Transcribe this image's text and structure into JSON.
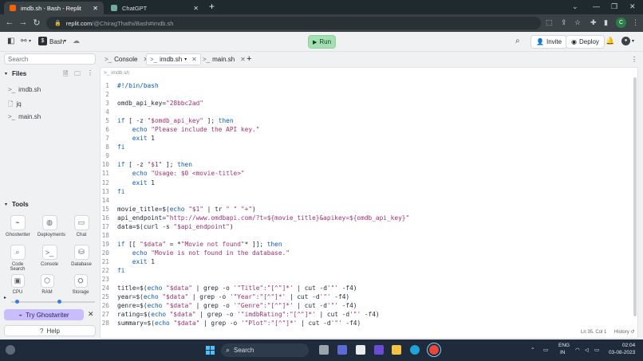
{
  "browser": {
    "tabs": [
      {
        "title": "imdb.sh - Bash - Replit",
        "active": true,
        "favicon_color": "#f26207"
      },
      {
        "title": "ChatGPT",
        "active": false,
        "favicon_color": "#74aa9c"
      }
    ],
    "new_tab": "+",
    "url_host": "replit.com",
    "url_path": "/@ChiragThathi/Bash#imdb.sh",
    "window_controls": [
      "chevron-down-icon",
      "minimize-icon",
      "restore-icon",
      "close-icon"
    ]
  },
  "replit_header": {
    "repl_name": "Bash",
    "run_label": "Run",
    "invite_label": "Invite",
    "deploy_label": "Deploy"
  },
  "sidebar": {
    "search_placeholder": "Search",
    "files_heading": "Files",
    "files": [
      {
        "name": "imdb.sh",
        "icon": "terminal-icon"
      },
      {
        "name": "jq",
        "icon": "file-icon"
      },
      {
        "name": "main.sh",
        "icon": "terminal-icon"
      }
    ],
    "tools_heading": "Tools",
    "tools": [
      {
        "label": "Ghostwriter",
        "icon": "ghostwriter-icon"
      },
      {
        "label": "Deployments",
        "icon": "globe-icon"
      },
      {
        "label": "Chat",
        "icon": "chat-icon"
      },
      {
        "label": "Code Search",
        "icon": "search-icon"
      },
      {
        "label": "Console",
        "icon": "terminal-icon"
      },
      {
        "label": "Database",
        "icon": "database-icon"
      }
    ],
    "resources": [
      {
        "label": "CPU",
        "level": 0.05
      },
      {
        "label": "RAM",
        "level": 0.55
      },
      {
        "label": "Storage",
        "level": 0.3
      }
    ],
    "ghostwriter_button": "Try Ghostwriter",
    "help_label": "Help"
  },
  "editor": {
    "tabs": [
      {
        "label": "Console",
        "active": false
      },
      {
        "label": "imdb.sh",
        "active": true
      },
      {
        "label": "main.sh",
        "active": false
      }
    ],
    "breadcrumb": "imdb.sh",
    "lines": [
      "#!/bin/bash",
      "",
      "omdb_api_key=\"28bbc2ad\"",
      "",
      "if [ -z \"$omdb_api_key\" ]; then",
      "    echo \"Please include the API key.\"",
      "    exit 1",
      "fi",
      "",
      "if [ -z \"$1\" ]; then",
      "    echo \"Usage: $0 <movie-title>\"",
      "    exit 1",
      "fi",
      "",
      "movie_title=$(echo \"$1\" | tr \" \" \"+\")",
      "api_endpoint=\"http://www.omdbapi.com/?t=${movie_title}&apikey=${omdb_api_key}\"",
      "data=$(curl -s \"$api_endpoint\")",
      "",
      "if [[ \"$data\" = *\"Movie not found\"* ]]; then",
      "    echo \"Movie is not found in the database.\"",
      "    exit 1",
      "fi",
      "",
      "title=$(echo \"$data\" | grep -o '\"Title\":\"[^\"]*' | cut -d'\"' -f4)",
      "year=$(echo \"$data\" | grep -o '\"Year\":\"[^\"]*' | cut -d'\"' -f4)",
      "genre=$(echo \"$data\" | grep -o '\"Genre\":\"[^\"]*' | cut -d'\"' -f4)",
      "rating=$(echo \"$data\" | grep -o '\"imdbRating\":\"[^\"]*' | cut -d'\"' -f4)",
      "summary=$(echo \"$data\" | grep -o '\"Plot\":\"[^\"]*' | cut -d'\"' -f4)"
    ],
    "cursor_position": "Ln 35, Col 1",
    "history_label": "History"
  },
  "taskbar": {
    "search_label": "Search",
    "language": "ENG",
    "region": "IN",
    "time": "02:04",
    "date": "03-08-2023"
  }
}
